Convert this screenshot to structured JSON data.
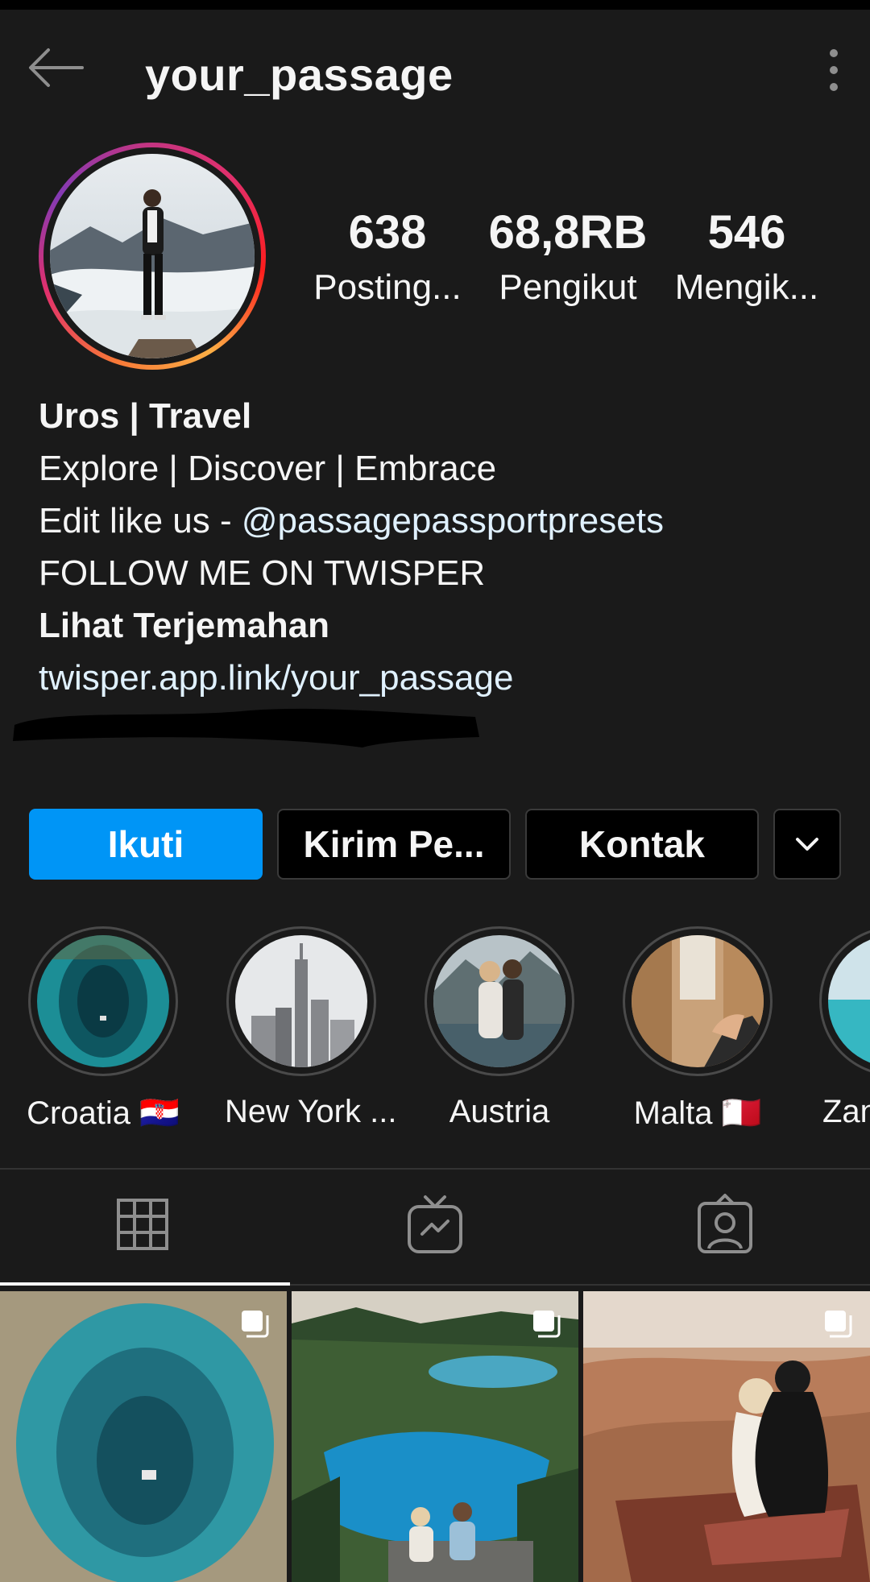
{
  "header": {
    "username": "your_passage"
  },
  "stats": [
    {
      "value": "638",
      "label": "Posting..."
    },
    {
      "value": "68,8RB",
      "label": "Pengikut"
    },
    {
      "value": "546",
      "label": "Mengik..."
    }
  ],
  "bio": {
    "name": "Uros | Travel",
    "line1": "Explore | Discover | Embrace",
    "line2_prefix": "Edit like us - ",
    "line2_mention": "@passagepassportpresets",
    "line3": "FOLLOW ME ON TWISPER",
    "translate": "Lihat Terjemahan",
    "link": "twisper.app.link/your_passage"
  },
  "buttons": {
    "follow": "Ikuti",
    "message": "Kirim Pe...",
    "contact": "Kontak"
  },
  "highlights": [
    {
      "label": "Croatia 🇭🇷"
    },
    {
      "label": "New York ..."
    },
    {
      "label": "Austria"
    },
    {
      "label": "Malta 🇲🇹"
    },
    {
      "label": "Zanz"
    }
  ],
  "tabs": [
    "grid-icon",
    "igtv-icon",
    "tagged-icon"
  ],
  "colors": {
    "accent": "#0095f6",
    "background": "#1a1a1a"
  }
}
